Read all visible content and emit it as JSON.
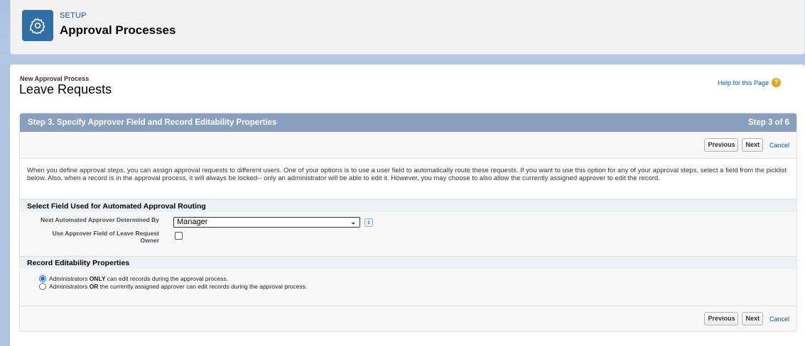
{
  "header": {
    "kicker": "SETUP",
    "title": "Approval Processes",
    "icon": "gear-icon"
  },
  "page": {
    "breadcrumb": "New Approval Process",
    "heading": "Leave Requests",
    "help_link": "Help for this Page",
    "help_icon": "?"
  },
  "step": {
    "title": "Step 3. Specify Approver Field and Record Editability Properties",
    "counter": "Step 3 of 6"
  },
  "buttons": {
    "previous": "Previous",
    "next": "Next",
    "cancel": "Cancel"
  },
  "description": "When you define approval steps, you can assign approval requests to different users. One of your options is to use a user field to automatically route these requests. If you want to use this option for any of your approval steps, select a field from the picklist below. Also, when a record is in the approval process, it will always be locked-- only an administrator will be able to edit it. However, you may choose to also allow the currently assigned approver to edit the record.",
  "routing": {
    "section_title": "Select Field Used for Automated Approval Routing",
    "approver_label": "Next Automated Approver Determined By",
    "approver_value": "Manager",
    "info_icon": "i",
    "owner_label_line1": "Use Approver Field of Leave Request",
    "owner_label_line2": "Owner",
    "owner_checked": false
  },
  "editability": {
    "section_title": "Record Editability Properties",
    "option1_prefix": "Administrators ",
    "option1_strong": "ONLY",
    "option1_suffix": " can edit records during the approval process.",
    "option2_prefix": "Administrators ",
    "option2_strong": "OR",
    "option2_suffix": " the currently assigned approver can edit records during the approval process.",
    "selected": 1
  },
  "colors": {
    "header_icon_bg": "#2f6fa3",
    "step_bar": "#8a9ebe",
    "link": "#015ba7",
    "help_icon": "#e5a21b"
  }
}
